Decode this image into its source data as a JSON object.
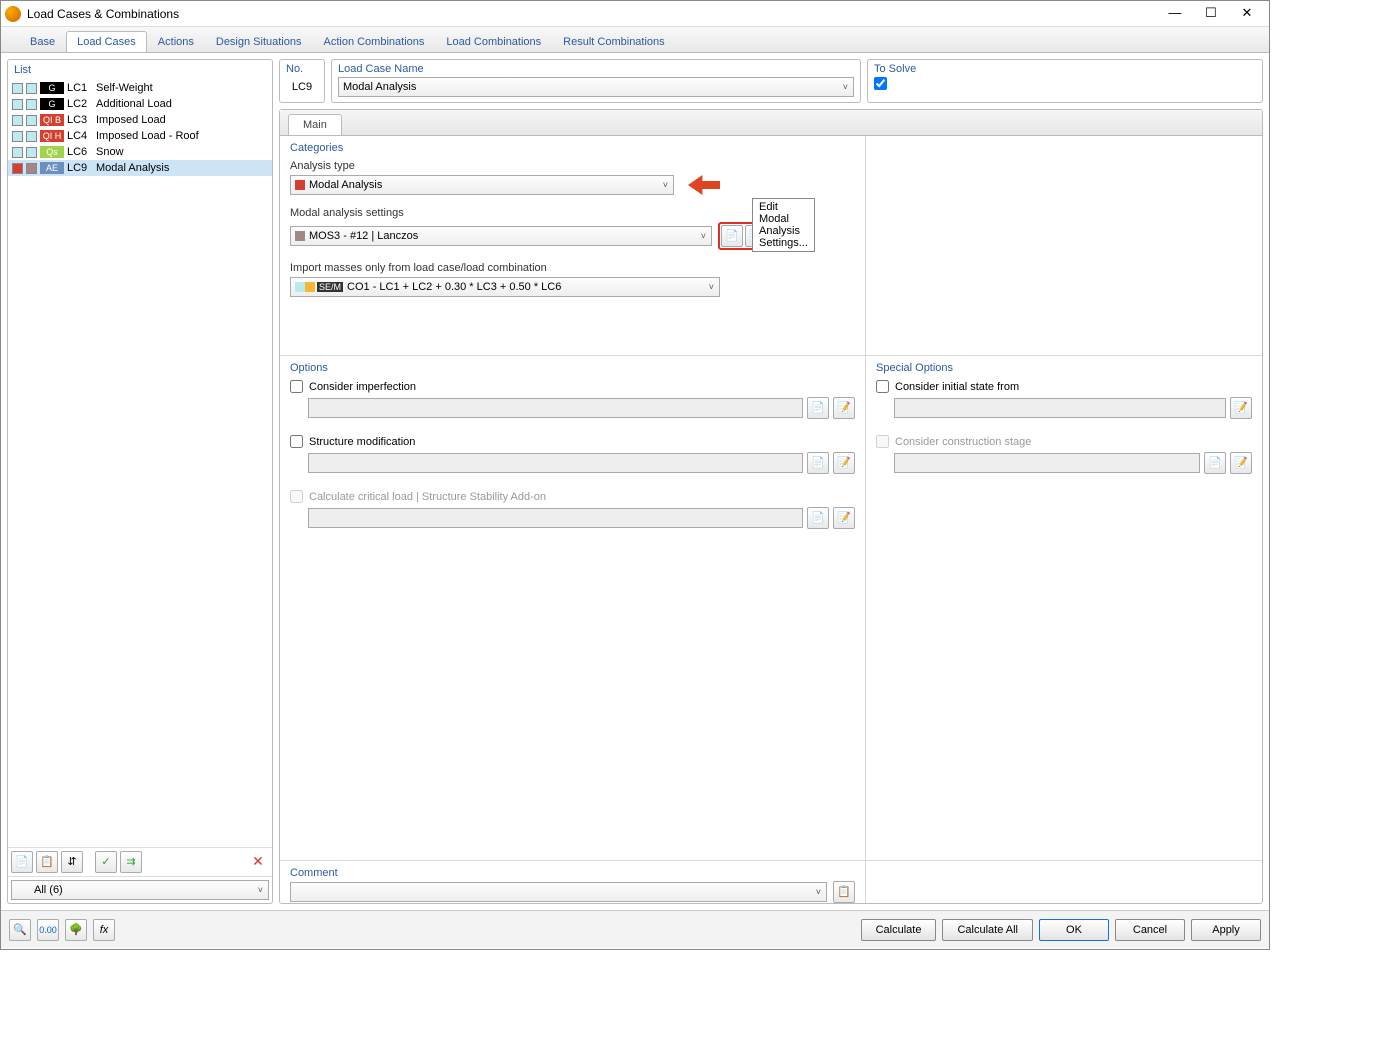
{
  "window": {
    "title": "Load Cases & Combinations"
  },
  "main_tabs": [
    "Base",
    "Load Cases",
    "Actions",
    "Design Situations",
    "Action Combinations",
    "Load Combinations",
    "Result Combinations"
  ],
  "active_main_tab": 1,
  "list": {
    "header": "List",
    "items": [
      {
        "swatch1": "#bdeaf0",
        "swatch2": "#bdeaf0",
        "tag": "G",
        "tagbg": "#000",
        "code": "LC1",
        "name": "Self-Weight"
      },
      {
        "swatch1": "#bdeaf0",
        "swatch2": "#bdeaf0",
        "tag": "G",
        "tagbg": "#000",
        "code": "LC2",
        "name": "Additional Load"
      },
      {
        "swatch1": "#bdeaf0",
        "swatch2": "#bdeaf0",
        "tag": "QI B",
        "tagbg": "#d43f2f",
        "code": "LC3",
        "name": "Imposed Load"
      },
      {
        "swatch1": "#bdeaf0",
        "swatch2": "#bdeaf0",
        "tag": "QI H",
        "tagbg": "#d43f2f",
        "code": "LC4",
        "name": "Imposed Load - Roof"
      },
      {
        "swatch1": "#bdeaf0",
        "swatch2": "#bdeaf0",
        "tag": "Qs",
        "tagbg": "#9fd44b",
        "code": "LC6",
        "name": "Snow"
      },
      {
        "swatch1": "#d43f2f",
        "swatch2": "#a28787",
        "tag": "AE",
        "tagbg": "#6a8fc0",
        "code": "LC9",
        "name": "Modal Analysis"
      }
    ],
    "selected_index": 5,
    "filter": "All (6)"
  },
  "no": {
    "label": "No.",
    "value": "LC9"
  },
  "load_case_name": {
    "label": "Load Case Name",
    "value": "Modal Analysis"
  },
  "to_solve": {
    "label": "To Solve",
    "checked": true
  },
  "sub_tab": "Main",
  "categories": {
    "title": "Categories",
    "analysis_type_label": "Analysis type",
    "analysis_type_value": "Modal Analysis",
    "modal_settings_label": "Modal analysis settings",
    "modal_settings_value": "MOS3 - #12 | Lanczos",
    "import_label": "Import masses only from load case/load combination",
    "import_tag": "SE/M",
    "import_value": "CO1 - LC1 + LC2 + 0.30 * LC3 + 0.50 * LC6",
    "tooltip": "Edit Modal Analysis Settings..."
  },
  "options": {
    "title": "Options",
    "consider_imperfection": "Consider imperfection",
    "structure_modification": "Structure modification",
    "critical_load": "Calculate critical load | Structure Stability Add-on"
  },
  "special_options": {
    "title": "Special Options",
    "initial_state": "Consider initial state from",
    "construction_stage": "Consider construction stage"
  },
  "comment": {
    "title": "Comment",
    "value": ""
  },
  "buttons": {
    "calculate": "Calculate",
    "calculate_all": "Calculate All",
    "ok": "OK",
    "cancel": "Cancel",
    "apply": "Apply"
  }
}
